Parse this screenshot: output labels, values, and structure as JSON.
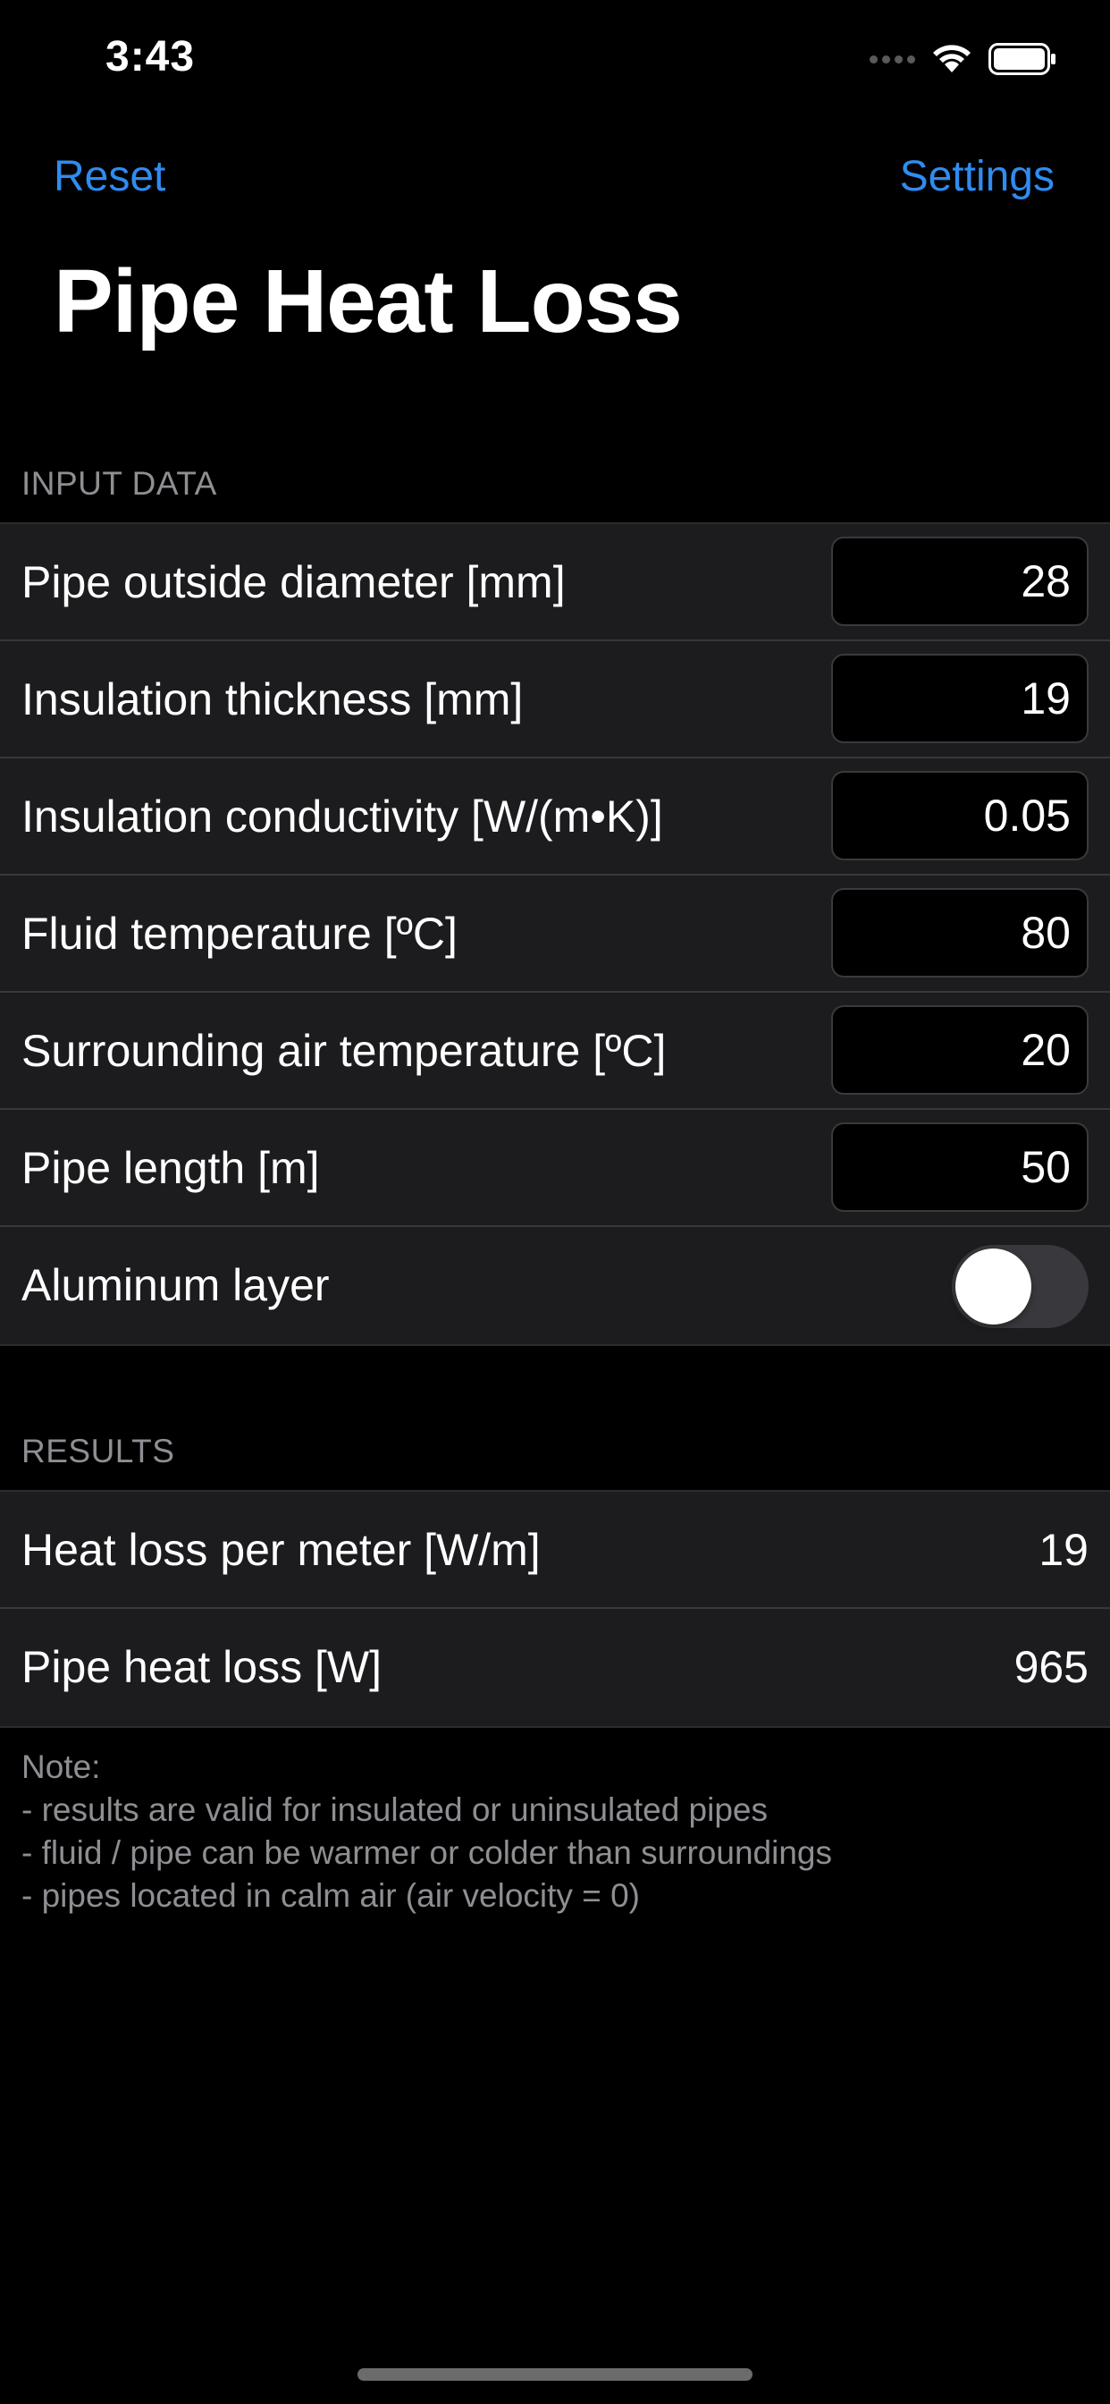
{
  "status_bar": {
    "time": "3:43"
  },
  "nav": {
    "reset_label": "Reset",
    "settings_label": "Settings"
  },
  "title": "Pipe Heat Loss",
  "input_section": {
    "header": "INPUT DATA",
    "rows": [
      {
        "label": "Pipe outside diameter [mm]",
        "value": "28"
      },
      {
        "label": "Insulation thickness [mm]",
        "value": "19"
      },
      {
        "label": "Insulation conductivity [W/(m•K)]",
        "value": "0.05"
      },
      {
        "label": "Fluid temperature [ºC]",
        "value": "80"
      },
      {
        "label": "Surrounding air temperature [ºC]",
        "value": "20"
      },
      {
        "label": "Pipe length [m]",
        "value": "50"
      }
    ],
    "toggle": {
      "label": "Aluminum layer",
      "on": false
    }
  },
  "results_section": {
    "header": "RESULTS",
    "rows": [
      {
        "label": "Heat loss per meter [W/m]",
        "value": "19"
      },
      {
        "label": "Pipe heat loss [W]",
        "value": "965"
      }
    ]
  },
  "note": {
    "lines": [
      "Note:",
      "- results are valid for insulated or uninsulated pipes",
      "- fluid / pipe can be warmer or colder than surroundings",
      "- pipes located in calm air (air velocity = 0)"
    ]
  },
  "colors": {
    "accent": "#2f8cf0",
    "background": "#000000",
    "cell": "#1c1c1e",
    "secondary_text": "#8e8e93"
  }
}
